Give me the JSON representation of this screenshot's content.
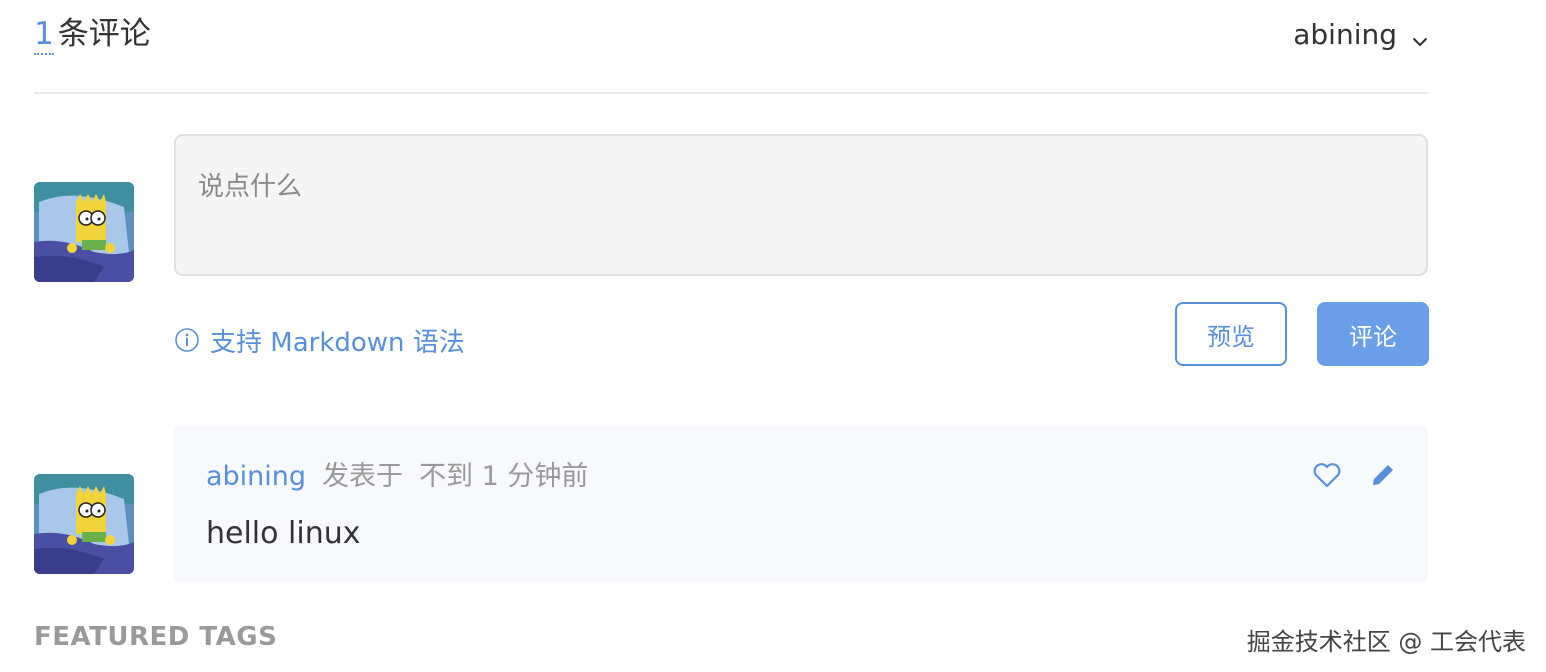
{
  "header": {
    "count": "1",
    "count_label": "条评论",
    "user": "abining"
  },
  "editor": {
    "placeholder": "说点什么",
    "value": ""
  },
  "markdown_hint": "支持 Markdown 语法",
  "buttons": {
    "preview": "预览",
    "submit": "评论"
  },
  "comments": [
    {
      "author": "abining",
      "posted_label": "发表于",
      "time": "不到 1 分钟前",
      "body": "hello linux"
    }
  ],
  "footer": {
    "featured_tags": "FEATURED TAGS",
    "watermark": "掘金技术社区 @ 工会代表"
  },
  "colors": {
    "accent": "#5a8fdc",
    "submit_bg": "#6a9ee6",
    "editor_bg": "#f5f5f5",
    "comment_bg": "#f7f9fd"
  },
  "icons": {
    "dropdown": "chevron-down-icon",
    "info": "info-circle-icon",
    "like": "heart-icon",
    "edit": "pencil-icon",
    "avatar": "user-avatar"
  }
}
